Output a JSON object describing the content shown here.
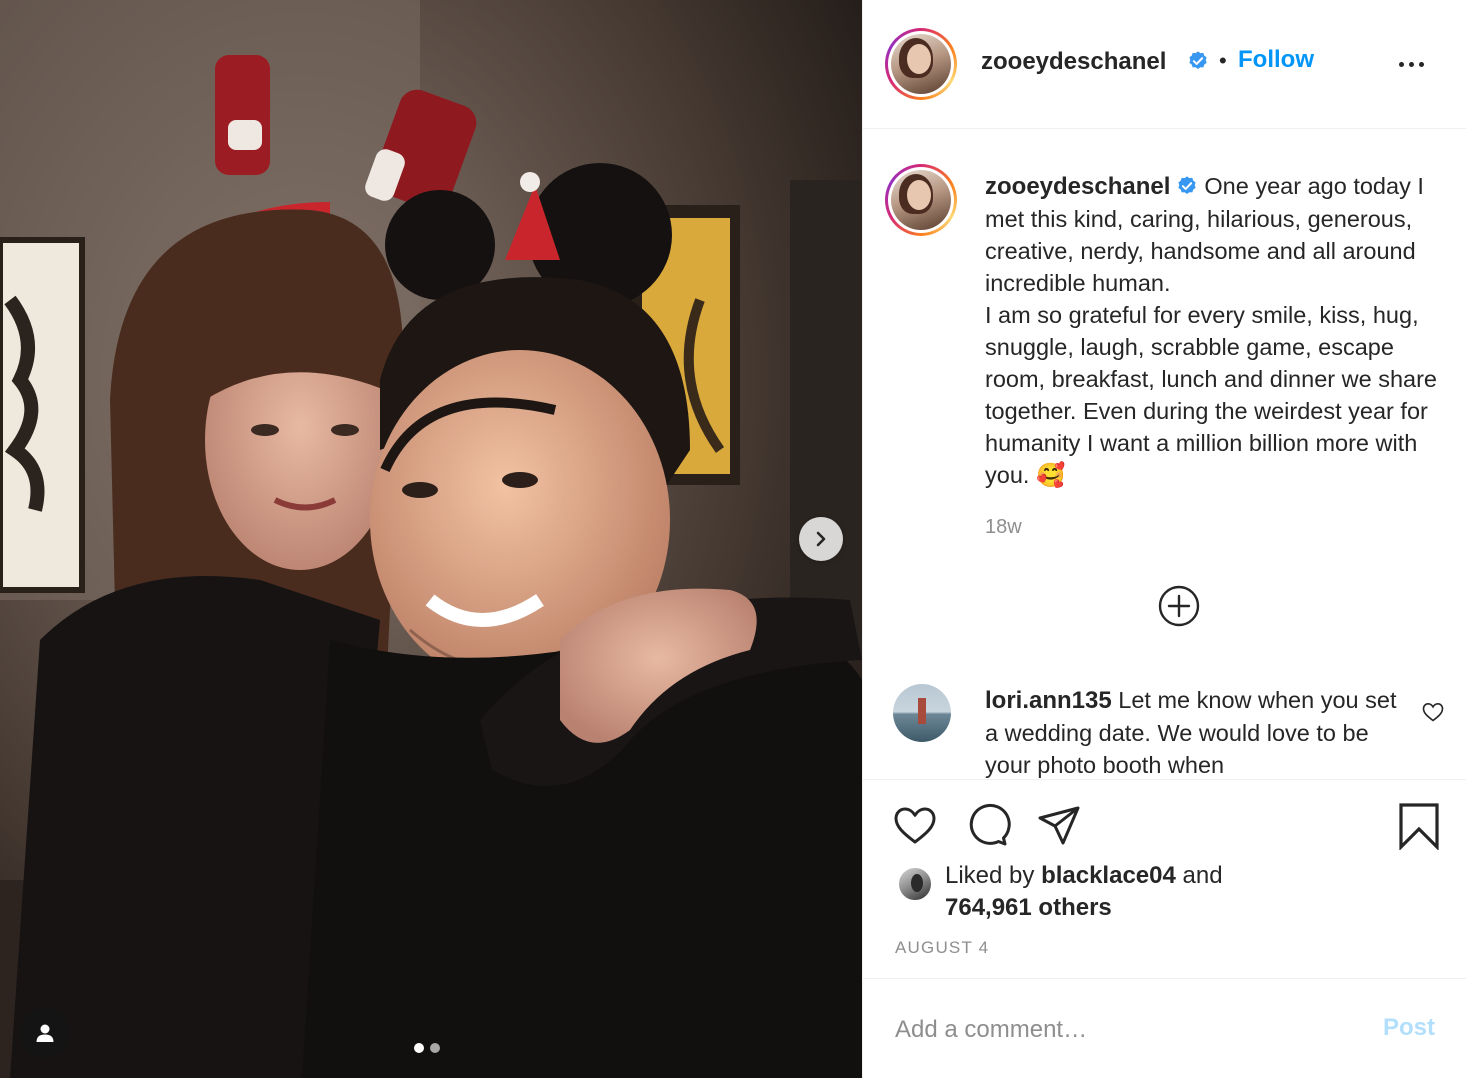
{
  "photo": {
    "carousel_count": 2,
    "carousel_active": 1
  },
  "post": {
    "username": "zooeydeschanel",
    "verified": true,
    "separator": "•",
    "follow_label": "Follow",
    "caption": "One year ago today I met this kind, caring, hilarious, generous, creative, nerdy, handsome and all around incredible human.",
    "caption_2": "I am so grateful for every smile, kiss, hug, snuggle, laugh, scrabble game, escape room, breakfast, lunch and dinner we share together. Even during the weirdest year for humanity I want a million billion more with you. 🥰",
    "time_ago": "18w"
  },
  "comments": [
    {
      "username": "lori.ann135",
      "text": "Let me know when you set a wedding date. We would love to be your photo booth when"
    }
  ],
  "likes": {
    "prefix": "Liked by ",
    "liked_by": "blacklace04",
    "conjunction": " and",
    "others": "764,961 others"
  },
  "date": "AUGUST 4",
  "comment_input": {
    "placeholder": "Add a comment…",
    "post_label": "Post"
  },
  "colors": {
    "accent": "#0095f6",
    "post_disabled": "#b2dffc",
    "muted": "#8e8e8e"
  }
}
